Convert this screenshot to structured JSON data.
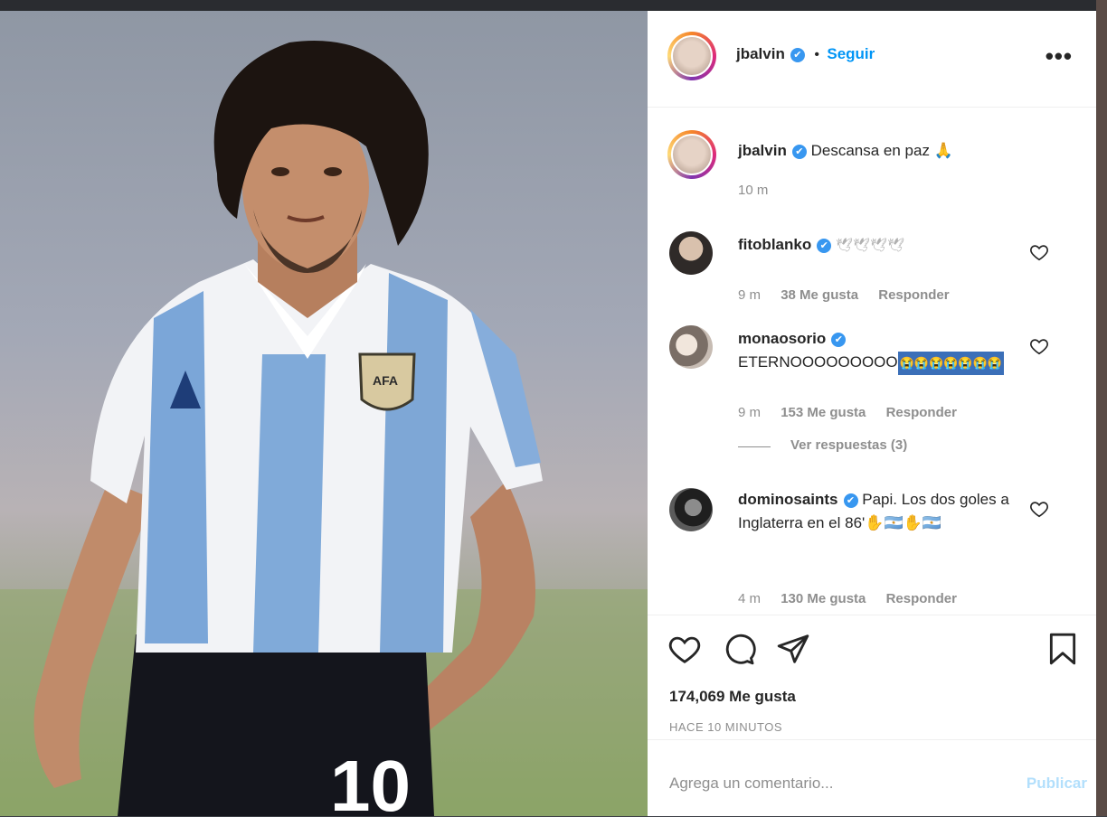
{
  "post": {
    "author": "jbalvin",
    "verified_mark": "✔",
    "follow_label": "Seguir",
    "separator": "•",
    "more_icon": "more-dots-icon",
    "caption": {
      "author": "jbalvin",
      "text": "Descansa en paz 🙏",
      "time": "10 m"
    }
  },
  "comments": [
    {
      "author": "fitoblanko",
      "text": "🕊🕊🕊🕊",
      "time": "9 m",
      "likes": "38 Me gusta",
      "reply_label": "Responder"
    },
    {
      "author": "monaosorio",
      "text": "ETERNOOOOOOOOO",
      "text_suffix": "😭😭😭😭😭😭😭",
      "time": "9 m",
      "likes": "153 Me gusta",
      "reply_label": "Responder",
      "view_replies": "Ver respuestas (3)"
    },
    {
      "author": "dominosaints",
      "text": "Papi. Los dos goles a Inglaterra en el 86'✋🇦🇷✋🇦🇷",
      "time": "4 m",
      "likes": "130 Me gusta",
      "reply_label": "Responder"
    }
  ],
  "actions": {
    "like_icon": "heart-icon",
    "comment_icon": "comment-icon",
    "share_icon": "send-icon",
    "save_icon": "bookmark-icon"
  },
  "likes_count": "174,069 Me gusta",
  "posted_ago": "HACE 10 MINUTOS",
  "add_comment": {
    "placeholder": "Agrega un comentario...",
    "publish_label": "Publicar"
  },
  "photo": {
    "jersey_number": "10",
    "badge_text": "AFA"
  },
  "colors": {
    "link_blue": "#0095f6",
    "verified_blue": "#3897f0",
    "muted": "#8e8e8e",
    "publish_disabled": "#b2dffc"
  }
}
